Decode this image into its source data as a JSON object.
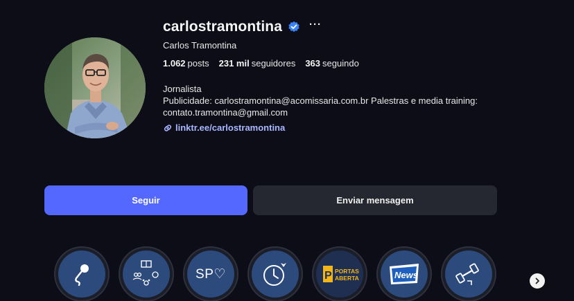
{
  "profile": {
    "username": "carlostramontina",
    "full_name": "Carlos Tramontina",
    "more_label": "···"
  },
  "stats": {
    "posts_count": "1.062",
    "posts_label": "posts",
    "followers_count": "231 mil",
    "followers_label": "seguidores",
    "following_count": "363",
    "following_label": "seguindo"
  },
  "bio": {
    "line1": "Jornalista",
    "line2": "Publicidade: carlostramontina@acomissaria.com.br Palestras e media training:",
    "line3": "contato.tramontina@gmail.com",
    "link": "linktr.ee/carlostramontina"
  },
  "actions": {
    "follow_label": "Seguir",
    "message_label": "Enviar mensagem"
  },
  "highlights": [
    {
      "icon": "microphone-icon"
    },
    {
      "icon": "people-book-icon"
    },
    {
      "text": "SP♡"
    },
    {
      "icon": "clock-icon"
    },
    {
      "text_top": "PORTAS",
      "text_bottom": "ABERTAS"
    },
    {
      "text": "News"
    },
    {
      "icon": "dumbbell-icon"
    }
  ],
  "colors": {
    "background": "#0c0d16",
    "follow_button": "#5468ff",
    "message_button": "#262831",
    "link": "#a9b8ff",
    "verified": "#3b82f6",
    "highlight_fill": "#2c4a7c"
  }
}
